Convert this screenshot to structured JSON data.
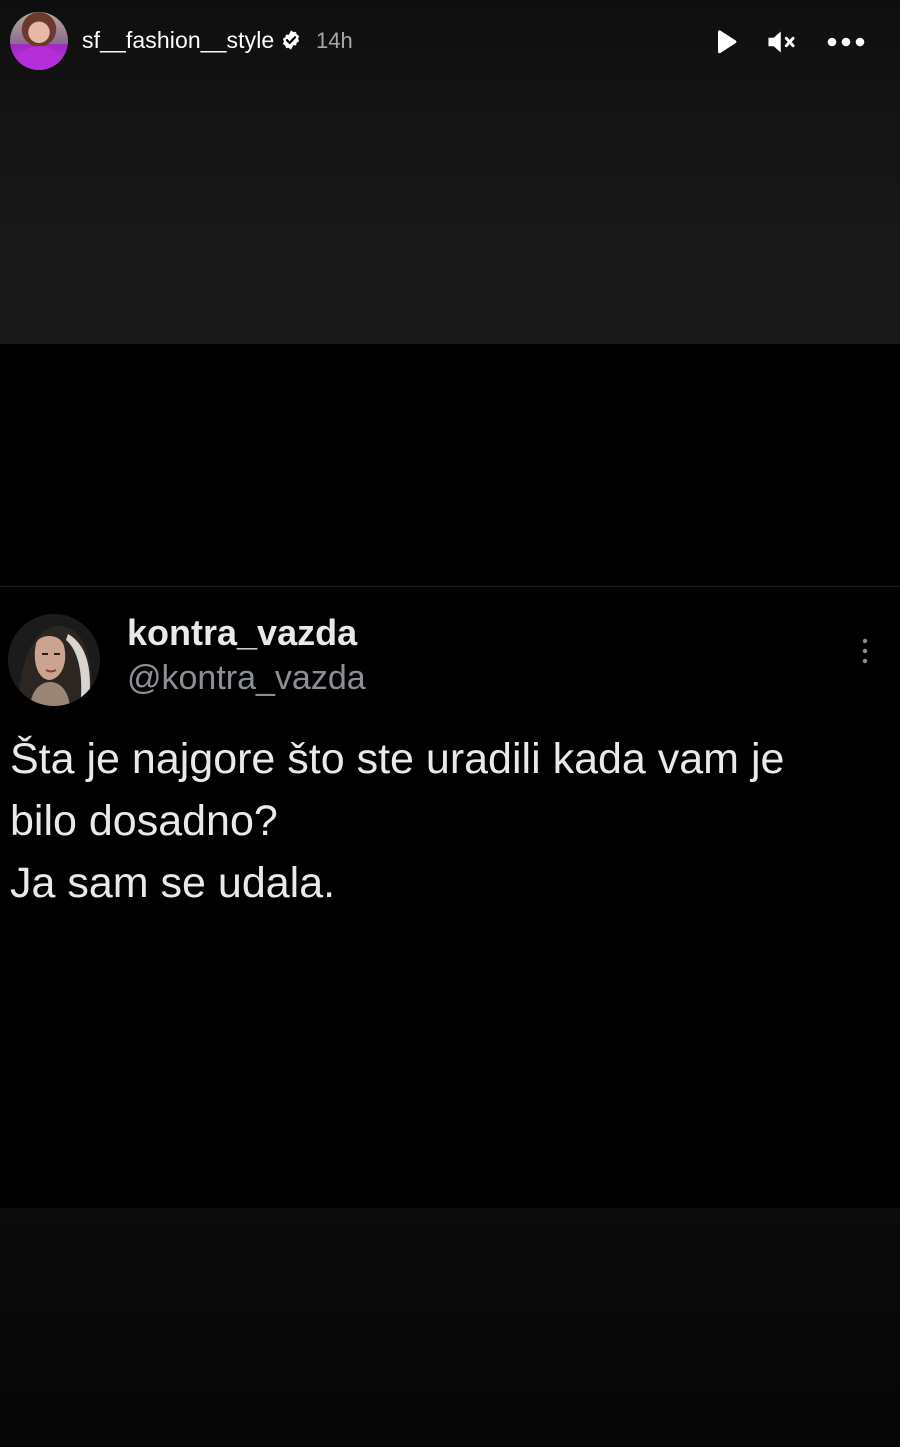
{
  "story_header": {
    "username": "sf__fashion__style",
    "time_ago": "14h",
    "icons": {
      "avatar": "profile-avatar",
      "verified": "verified-badge-icon",
      "play": "play-icon",
      "mute": "muted-speaker-icon",
      "more": "more-options-icon"
    }
  },
  "tweet": {
    "display_name": "kontra_vazda",
    "handle": "@kontra_vazda",
    "text_lines": [
      "Šta je najgore što ste uradili kada vam je",
      "bilo dosadno?",
      "Ja sam se udala."
    ],
    "icons": {
      "menu": "vertical-dots-icon"
    }
  },
  "colors": {
    "background": "#000000",
    "primary_text": "#e7e9ea",
    "secondary_text": "#8b8f94",
    "time_text": "#a8a8a8"
  }
}
